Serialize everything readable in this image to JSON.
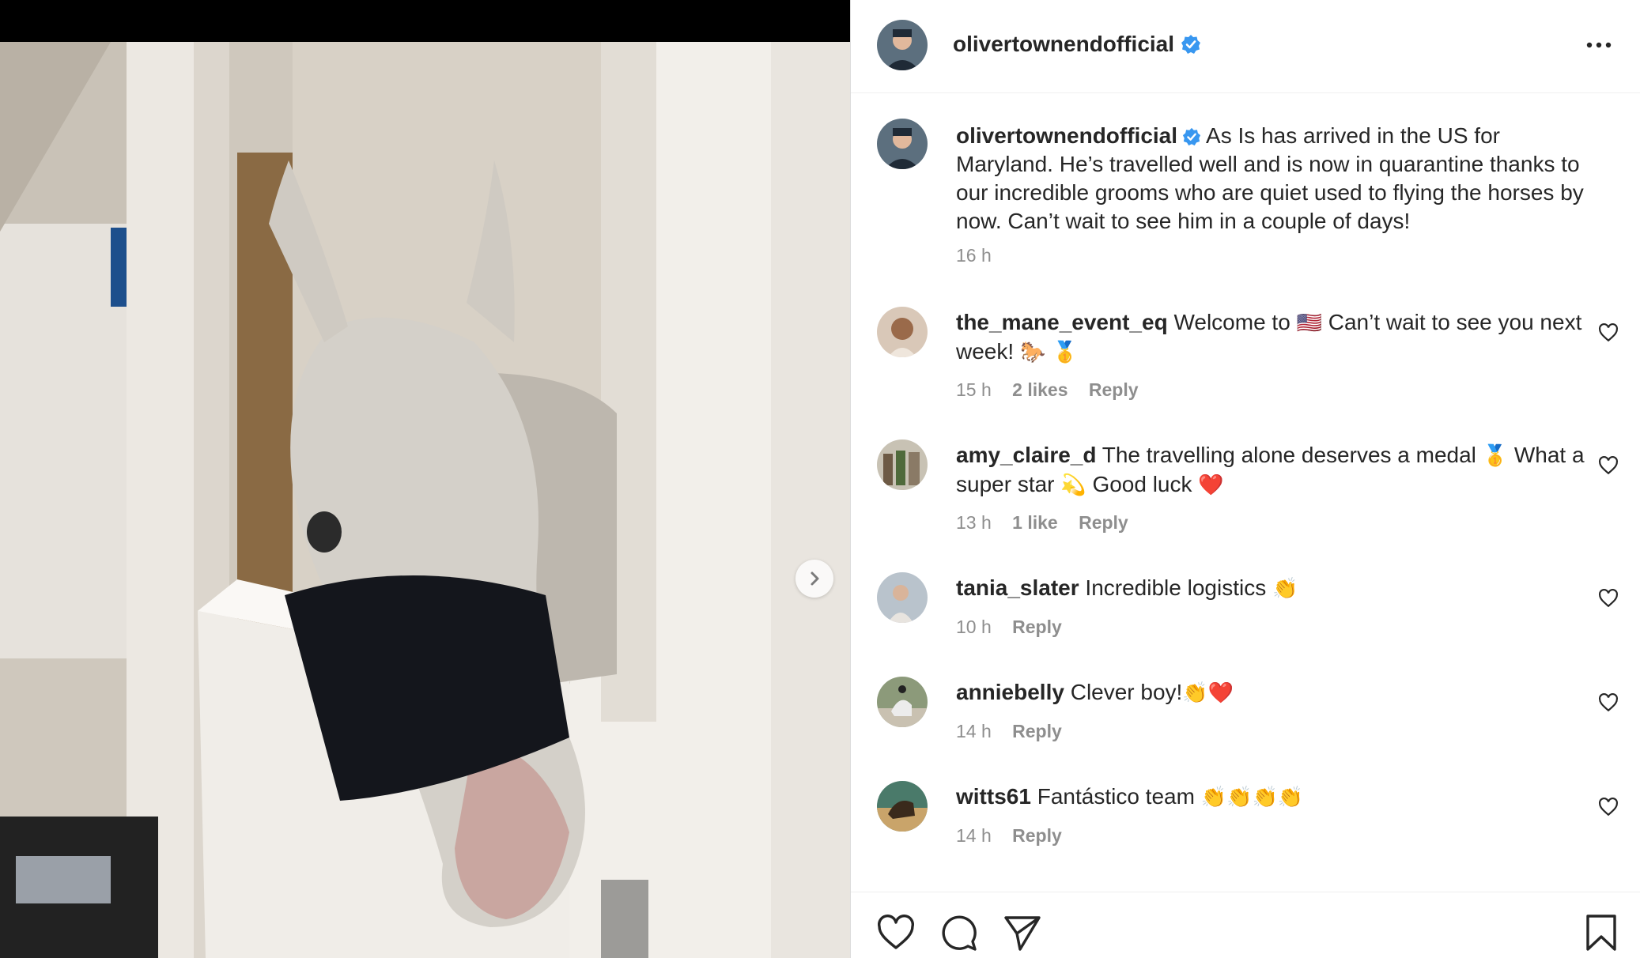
{
  "post": {
    "username": "olivertownendofficial",
    "verified": true,
    "caption_text": "As Is has arrived in the US for Maryland. He’s travelled well and is now in quarantine thanks to our incredible grooms who are quiet used to flying the horses by now. Can’t wait to see him in a couple of days!",
    "caption_time": "16 h"
  },
  "comments": [
    {
      "user": "the_mane_event_eq",
      "text_a": "Welcome to",
      "emoji_a": "🇺🇸",
      "text_b": "Can’t wait to see you next week!",
      "emoji_b": "🐎 🥇",
      "time": "15 h",
      "likes": "2 likes",
      "reply": "Reply"
    },
    {
      "user": "amy_claire_d",
      "text_a": "The travelling alone deserves a medal",
      "emoji_a": "🥇",
      "text_b": "What a super star",
      "emoji_b": "💫",
      "text_c": "Good luck",
      "emoji_c": "❤️",
      "time": "13 h",
      "likes": "1 like",
      "reply": "Reply"
    },
    {
      "user": "tania_slater",
      "text_a": "Incredible logistics",
      "emoji_a": "👏",
      "time": "10 h",
      "reply": "Reply"
    },
    {
      "user": "anniebelly",
      "text_a": "Clever boy!",
      "emoji_a": "👏❤️",
      "time": "14 h",
      "reply": "Reply"
    },
    {
      "user": "witts61",
      "text_a": "Fantástico team",
      "emoji_a": "👏👏👏👏",
      "time": "14 h",
      "reply": "Reply"
    }
  ],
  "colors": {
    "verified": "#3897f0",
    "secondary_text": "#8e8e8e",
    "primary_text": "#262626"
  },
  "icons": [
    "more-options-icon",
    "verified-badge-icon",
    "heart-icon",
    "comment-icon",
    "share-icon",
    "bookmark-icon",
    "chevron-right-icon"
  ]
}
